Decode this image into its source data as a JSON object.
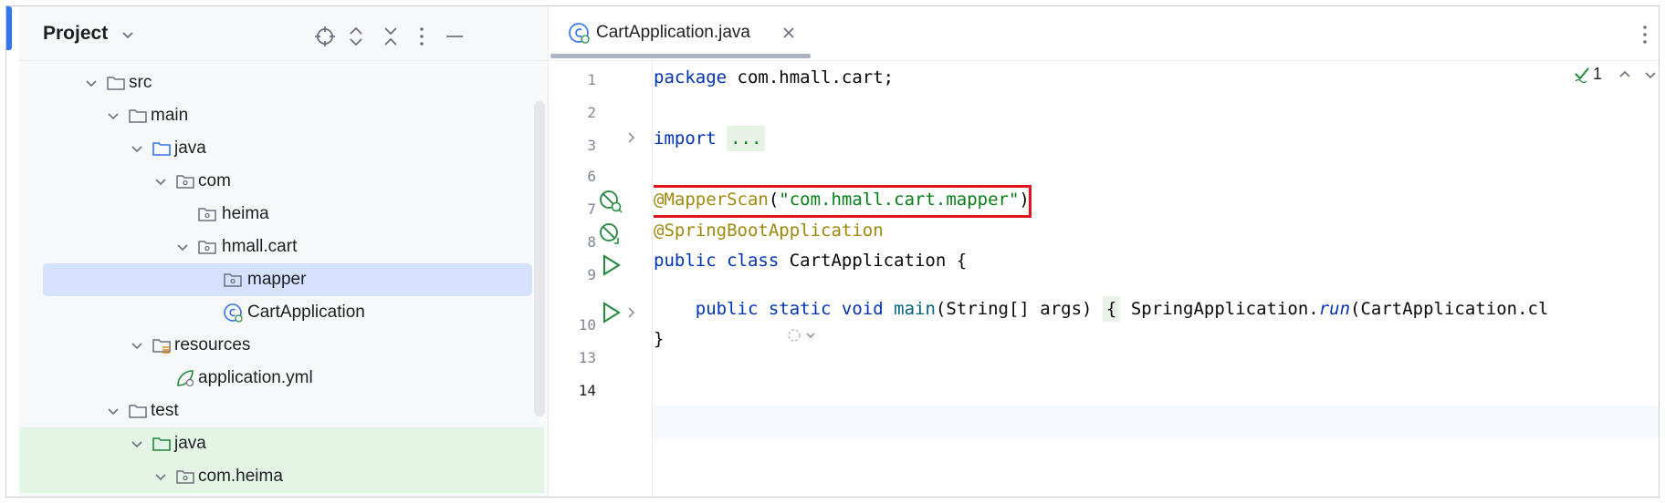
{
  "project_panel": {
    "title": "Project",
    "toolbar_icons": [
      "locate-icon",
      "expand-all-icon",
      "collapse-all-icon",
      "more-icon",
      "minimize-icon"
    ]
  },
  "tree": [
    {
      "label": "src",
      "icon": "folder",
      "expanded": true
    },
    {
      "label": "main",
      "icon": "folder",
      "expanded": true
    },
    {
      "label": "java",
      "icon": "source-folder",
      "expanded": true
    },
    {
      "label": "com",
      "icon": "package",
      "expanded": true
    },
    {
      "label": "heima",
      "icon": "package"
    },
    {
      "label": "hmall.cart",
      "icon": "package",
      "expanded": true
    },
    {
      "label": "mapper",
      "icon": "package",
      "selected": true
    },
    {
      "label": "CartApplication",
      "icon": "spring-class"
    },
    {
      "label": "resources",
      "icon": "resources-folder",
      "expanded": true
    },
    {
      "label": "application.yml",
      "icon": "spring-config"
    },
    {
      "label": "test",
      "icon": "folder",
      "expanded": true
    },
    {
      "label": "java",
      "icon": "test-folder",
      "expanded": true
    },
    {
      "label": "com.heima",
      "icon": "package",
      "expanded": true
    }
  ],
  "editor": {
    "tab_label": "CartApplication.java",
    "inspection_count": "1",
    "line_numbers": [
      "1",
      "2",
      "3",
      "6",
      "7",
      "8",
      "9",
      "10",
      "13",
      "14"
    ],
    "code": {
      "l1_kw": "package",
      "l1_rest": " com.hmall.cart;",
      "l3_kw": "import",
      "l3_fold": "...",
      "l7_ann": "@MapperScan",
      "l7_open": "(",
      "l7_str": "\"com.hmall.cart.mapper\"",
      "l7_close": ")",
      "l8_ann": "@SpringBootApplication",
      "l9_kw": "public class",
      "l9_rest": " CartApplication {",
      "l10_kw": "public static void",
      "l10_fn": "main",
      "l10_args": "(String[] args) ",
      "l10_brace": "{",
      "l10_call": " SpringApplication.",
      "l10_run": "run",
      "l10_tail": "(CartApplication.cl",
      "l13": "}"
    }
  },
  "colors": {
    "accent": "#3574f0",
    "selection": "#d5e1ff",
    "test_background": "#e4f5e6",
    "highlight_border": "#e0141e",
    "run_icon": "#208a3c"
  }
}
